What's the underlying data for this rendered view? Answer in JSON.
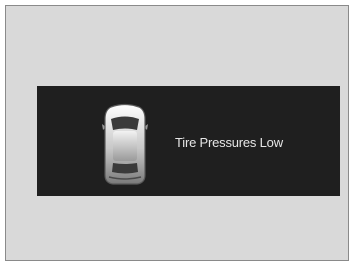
{
  "display": {
    "message": "Tire Pressures Low",
    "icon": "car-top-view-icon"
  },
  "colors": {
    "frame_background": "#d9d9d9",
    "panel_background": "#1f1f1f",
    "message_text": "#e6e6e6"
  }
}
